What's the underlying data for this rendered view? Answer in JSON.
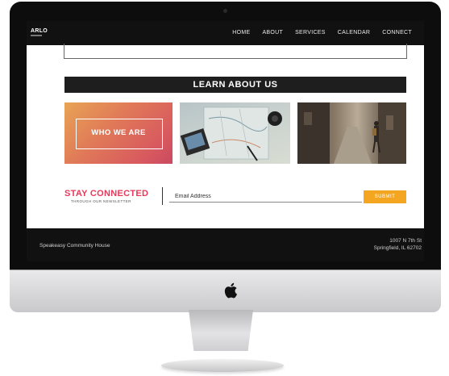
{
  "nav": {
    "logo": "ARLO",
    "items": [
      "HOME",
      "ABOUT",
      "SERVICES",
      "CALENDAR",
      "CONNECT"
    ]
  },
  "learn": {
    "title": "LEARN ABOUT US",
    "cards": [
      {
        "label": "WHO WE ARE"
      }
    ]
  },
  "stay": {
    "title": "STAY CONNECTED",
    "subtitle": "THROUGH OUR NEWSLETTER",
    "email_placeholder": "Email Address",
    "submit": "SUBMIT"
  },
  "footer": {
    "left": "Speakeasy Community House",
    "address_line1": "1007 N 7th St",
    "address_line2": "Springfield, IL 62702"
  },
  "colors": {
    "accent_pink": "#e8385a",
    "submit_orange": "#f4a620",
    "dark": "#111111"
  },
  "icons": [
    "apple-logo-icon"
  ]
}
